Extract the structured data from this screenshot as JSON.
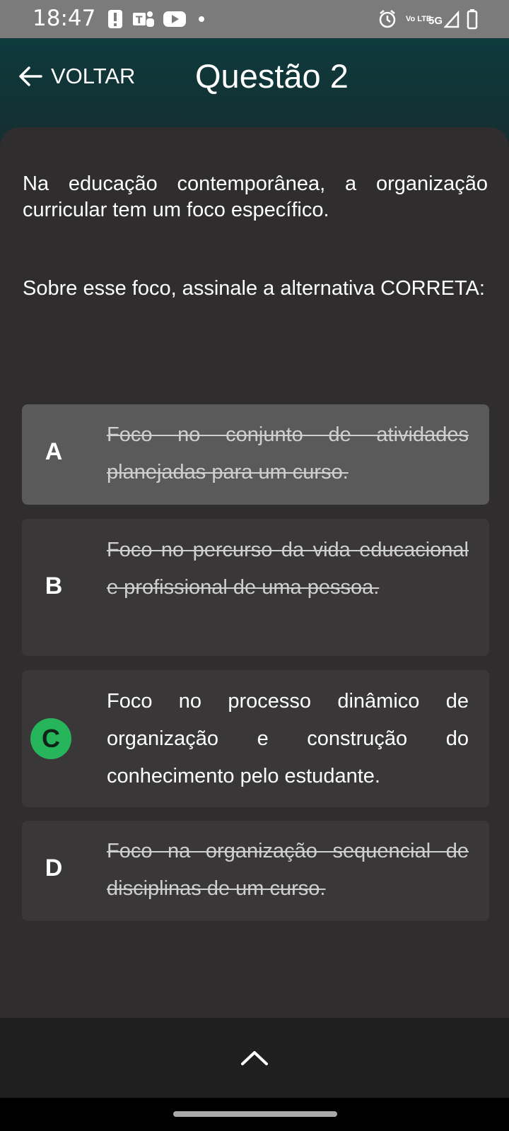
{
  "status_bar": {
    "time": "18:47",
    "network": "5G",
    "volte": "Vo LTE"
  },
  "header": {
    "back_label": "VOLTAR",
    "title": "Questão 2"
  },
  "question": {
    "paragraph1": "Na educação contemporânea, a organização curricular tem um foco específico.",
    "paragraph2": "Sobre esse foco, assinale a alternativa CORRETA:"
  },
  "options": [
    {
      "letter": "A",
      "text": "Foco no conjunto de atividades planejadas para um curso.",
      "struck": true,
      "selected": true
    },
    {
      "letter": "B",
      "text": "Foco no percurso da vida educacional e profissional de uma pessoa.",
      "struck": true,
      "selected": false
    },
    {
      "letter": "C",
      "text": "Foco no processo dinâmico de organização e construção do conhecimento pelo estudante.",
      "struck": false,
      "correct": true
    },
    {
      "letter": "D",
      "text": "Foco na organização sequencial de disciplinas de um curso.",
      "struck": true,
      "selected": false
    }
  ],
  "colors": {
    "correct": "#27b55c",
    "selected_bg": "#5b5a5b",
    "option_bg": "#393738",
    "header_teal": "#0e3a3d"
  },
  "icons": {
    "back": "arrow-left-icon",
    "collapse": "chevron-up-icon"
  }
}
